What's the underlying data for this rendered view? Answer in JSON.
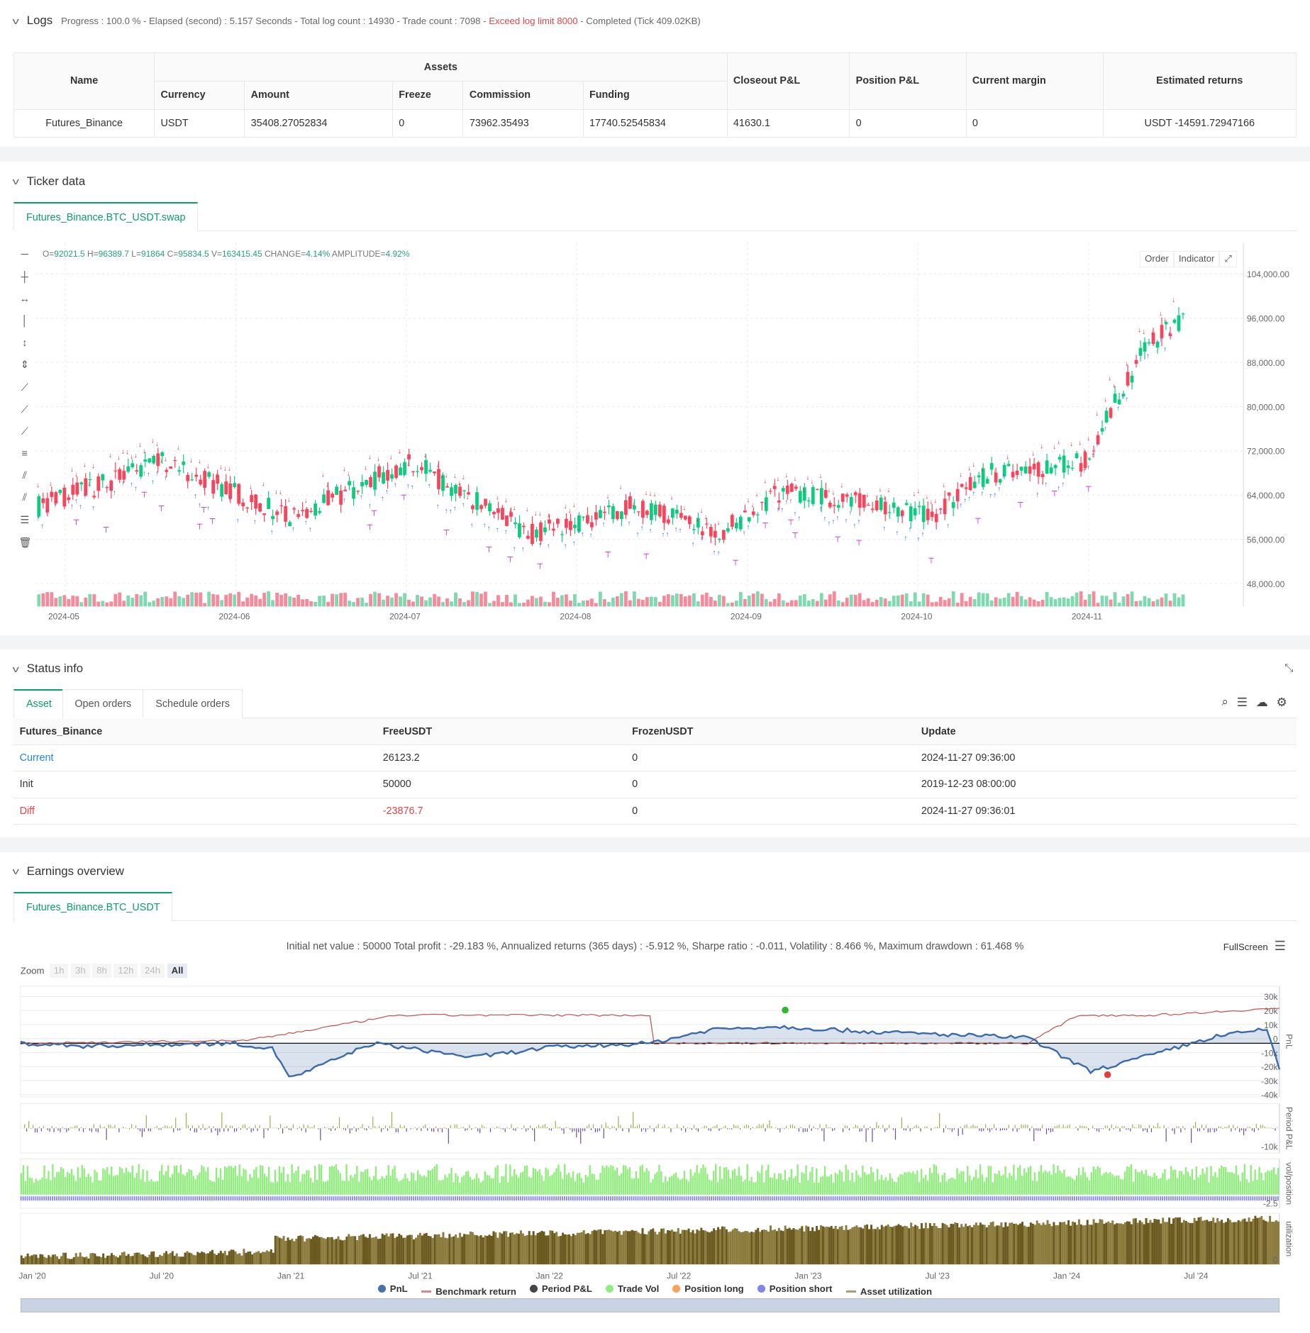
{
  "logs": {
    "title": "Logs",
    "progress": "Progress : 100.0 % - Elapsed (second) : 5.157  Seconds - Total log count : 14930 - Trade count : 7098 - ",
    "warn": "Exceed log limit 8000",
    "done": " - Completed (Tick 409.02KB)"
  },
  "assets": {
    "headers": {
      "name": "Name",
      "assets": "Assets",
      "currency": "Currency",
      "amount": "Amount",
      "freeze": "Freeze",
      "commission": "Commission",
      "funding": "Funding",
      "closeout": "Closeout P&L",
      "position": "Position P&L",
      "margin": "Current margin",
      "returns": "Estimated returns"
    },
    "row": {
      "name": "Futures_Binance",
      "currency": "USDT",
      "amount": "35408.27052834",
      "freeze": "0",
      "commission": "73962.35493",
      "funding": "17740.52545834",
      "closeout": "41630.1",
      "position": "0",
      "margin": "0",
      "returns": "USDT -14591.72947166"
    }
  },
  "ticker": {
    "title": "Ticker data",
    "tab": "Futures_Binance.BTC_USDT.swap",
    "ohlc": {
      "o_label": "O=",
      "o": "92021.5",
      "h_label": "H=",
      "h": "96389.7",
      "l_label": "L=",
      "l": "91864",
      "c_label": "C=",
      "c": "95834.5",
      "v_label": "V=",
      "v": "163415.45",
      "chg_label": "CHANGE=",
      "chg": "4.14%",
      "amp_label": "AMPLITUDE=",
      "amp": "4.92%"
    },
    "buttons": {
      "order": "Order",
      "indicator": "Indicator"
    },
    "yticks": [
      "104,000.00",
      "96,000.00",
      "88,000.00",
      "80,000.00",
      "72,000.00",
      "64,000.00",
      "56,000.00",
      "48,000.00"
    ],
    "xticks": [
      "2024-05",
      "2024-06",
      "2024-07",
      "2024-08",
      "2024-09",
      "2024-10",
      "2024-11"
    ]
  },
  "status": {
    "title": "Status info",
    "tabs": [
      "Asset",
      "Open orders",
      "Schedule orders"
    ],
    "headers": [
      "Futures_Binance",
      "FreeUSDT",
      "FrozenUSDT",
      "Update"
    ],
    "rows": [
      [
        "Current",
        "26123.2",
        "0",
        "2024-11-27 09:36:00"
      ],
      [
        "Init",
        "50000",
        "0",
        "2019-12-23 08:00:00"
      ],
      [
        "Diff",
        "-23876.7",
        "0",
        "2024-11-27 09:36:01"
      ]
    ]
  },
  "earnings": {
    "title": "Earnings overview",
    "tab": "Futures_Binance.BTC_USDT",
    "summary": "Initial net value : 50000 Total profit : -29.183 %, Annualized returns (365 days) : -5.912 %, Sharpe ratio : -0.011, Volatility : 8.466 %, Maximum drawdown : 61.468 %",
    "fullscreen": "FullScreen",
    "zoom_label": "Zoom",
    "zoom": [
      "1h",
      "3h",
      "8h",
      "12h",
      "24h",
      "All"
    ],
    "pnl_ticks": [
      "30k",
      "20k",
      "10k",
      "0",
      "-10k",
      "-20k",
      "-30k",
      "-40k"
    ],
    "period_tick": "-10k",
    "vol_tick": "-2.5",
    "util_tick": "0",
    "axis_titles": [
      "PnL",
      "Period P&L",
      "vol/position",
      "utilization"
    ],
    "xticks": [
      "Jan '20",
      "Jul '20",
      "Jan '21",
      "Jul '21",
      "Jan '22",
      "Jul '22",
      "Jan '23",
      "Jul '23",
      "Jan '24",
      "Jul '24"
    ],
    "legend": [
      {
        "label": "PnL",
        "color": "#4572a7"
      },
      {
        "label": "Benchmark return",
        "color": "#d9888f"
      },
      {
        "label": "Period P&L",
        "color": "#434348"
      },
      {
        "label": "Trade Vol",
        "color": "#90ed7d"
      },
      {
        "label": "Position long",
        "color": "#f7a35c"
      },
      {
        "label": "Position short",
        "color": "#8085e9"
      },
      {
        "label": "Asset utilization",
        "color": "#a89f70"
      }
    ]
  }
}
